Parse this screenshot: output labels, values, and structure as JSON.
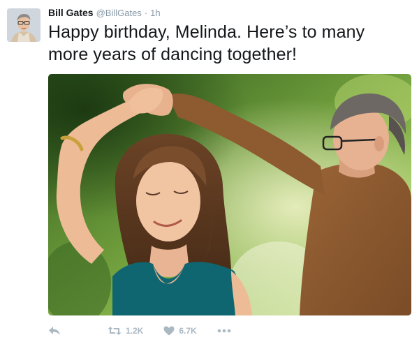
{
  "tweet": {
    "author": {
      "display_name": "Bill Gates",
      "handle": "@BillGates",
      "avatar_icon": "profile-avatar"
    },
    "separator": "·",
    "timestamp": "1h",
    "text": "Happy birthday, Melinda. Here’s to many more years of dancing together!",
    "media": {
      "type": "photo"
    },
    "actions": {
      "reply_icon": "reply-icon",
      "retweet_icon": "retweet-icon",
      "retweet_count": "1.2K",
      "like_icon": "heart-icon",
      "like_count": "6.7K",
      "more_icon": "more-icon"
    },
    "colors": {
      "text": "#14171a",
      "meta": "#8899a6",
      "action": "#aab8c2"
    }
  }
}
